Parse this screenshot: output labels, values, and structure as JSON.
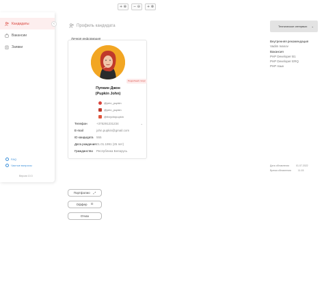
{
  "zoom": {
    "buttons": [
      {
        "label": "+ ⊕",
        "icon": "plus-icon"
      },
      {
        "label": "− ⊖",
        "icon": "minus-icon"
      },
      {
        "label": "+ ⊗",
        "icon": "reset-icon"
      }
    ]
  },
  "sidebar": {
    "items": [
      {
        "label": "Кандидаты",
        "icon": "users-icon",
        "active": true
      },
      {
        "label": "Вакансии",
        "icon": "briefcase-icon",
        "active": false
      },
      {
        "label": "Заявки",
        "icon": "clipboard-icon",
        "active": false
      }
    ],
    "collapse_label": "‹",
    "bottom_links": [
      {
        "label": "FAQ",
        "icon": "help-icon"
      },
      {
        "label": "Частые вопросы",
        "icon": "question-icon"
      }
    ],
    "version": "Версия 10.3"
  },
  "breadcrumb": {
    "label": "Профиль кандидата"
  },
  "status": {
    "value": "Техническое интервью",
    "chevron": "⌄"
  },
  "right_panel": {
    "lines": [
      {
        "text": "Внутренняя рекомендация",
        "header": true
      },
      {
        "text": "Vadim Ivanov",
        "header": false
      },
      {
        "text": "Вакансия",
        "header": true
      },
      {
        "text": "PHP Developer B1",
        "header": false
      },
      {
        "text": "PHP Developer ERQ",
        "header": false
      },
      {
        "text": "PHP язык",
        "header": false
      }
    ]
  },
  "dates": {
    "created_label": "Дата обновления",
    "created_value": "01.07.2022",
    "updated_label": "Время обновления",
    "updated_value": "11:15"
  },
  "card": {
    "title": "Личная информация",
    "badge": "Подробный статус",
    "name_line1": "Пупкин Джон",
    "name_line2": "(Pupkin John)",
    "socials": [
      {
        "handle": "@john_pupkin",
        "icon": "telegram-icon",
        "color": "#d9443b"
      },
      {
        "handle": "@john_pupkin",
        "icon": "instagram-icon",
        "color": "#c0392b"
      },
      {
        "handle": "@thejohnpupkin",
        "icon": "facebook-icon",
        "color": "#e0563c"
      }
    ],
    "fields": [
      {
        "label": "Телефон",
        "value": "+375291231234",
        "chevron": "⌄"
      },
      {
        "label": "E-mail",
        "value": "john.pupkin@gmail.com",
        "chevron": ""
      },
      {
        "label": "ID кандидата",
        "value": "555",
        "chevron": ""
      },
      {
        "label": "Дата рождения",
        "value": "01.01.1991 (25 лет)",
        "chevron": ""
      },
      {
        "label": "Гражданство",
        "value": "Республика Беларусь",
        "chevron": ""
      }
    ]
  },
  "actions": [
    {
      "label": "Портфолио",
      "icon": "link-icon",
      "glyph": "⤢"
    },
    {
      "label": "Оффер",
      "icon": "lock-icon",
      "glyph": "⊡"
    },
    {
      "label": "Отказ",
      "icon": "",
      "glyph": ""
    }
  ],
  "colors": {
    "accent": "#d9443b",
    "avatar_bg": "#f2a623",
    "link": "#3b8fd9"
  }
}
